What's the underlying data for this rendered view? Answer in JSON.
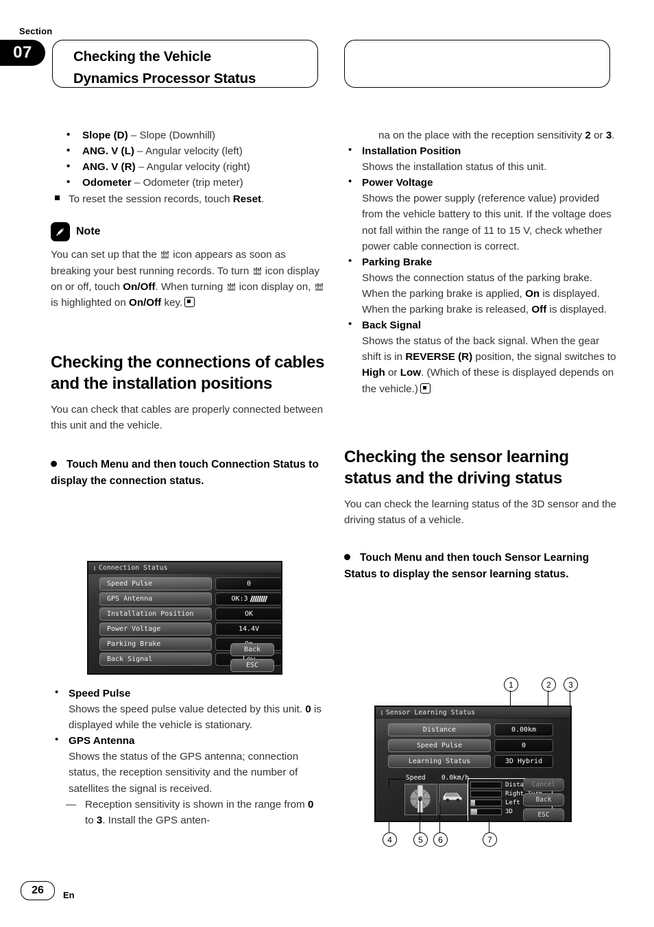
{
  "header": {
    "section_word": "Section",
    "section_number": "07",
    "title_line1": "Checking the Vehicle",
    "title_line2": "Dynamics Processor Status"
  },
  "left_column": {
    "param_list": [
      {
        "term": "Slope (D)",
        "desc": " – Slope (Downhill)"
      },
      {
        "term": "ANG. V (L)",
        "desc": " – Angular velocity (left)"
      },
      {
        "term": "ANG. V (R)",
        "desc": " – Angular velocity (right)"
      },
      {
        "term": "Odometer",
        "desc": " – Odometer (trip meter)"
      }
    ],
    "reset_note_pre": "To reset the session records, touch ",
    "reset_note_bold": "Reset",
    "reset_note_post": ".",
    "note": {
      "icon": "pencil-icon",
      "title": "Note",
      "text_1": "You can set up that the ",
      "text_2": " icon appears as soon as breaking your best running records. To turn ",
      "text_3": " icon display on or off, touch ",
      "bold_onoff_1": "On/Off",
      "text_4": ". When turning ",
      "text_5": " icon display on, ",
      "text_6": " is highlighted on ",
      "bold_onoff_2": "On/Off",
      "text_7": " key."
    },
    "heading": "Checking the connections of cables and the installation positions",
    "intro": "You can check that cables are properly connected between this unit and the vehicle.",
    "procedure": "Touch Menu and then touch Connection Status to display the connection status.",
    "device_screen": {
      "title": "Connection Status",
      "rows": [
        {
          "label": "Speed Pulse",
          "value": "0",
          "has_bars": false
        },
        {
          "label": "GPS Antenna",
          "value": "OK:3",
          "has_bars": true
        },
        {
          "label": "Installation Position",
          "value": "OK",
          "has_bars": false
        },
        {
          "label": "Power Voltage",
          "value": "14.4V",
          "has_bars": false
        },
        {
          "label": "Parking Brake",
          "value": "On",
          "has_bars": false
        },
        {
          "label": "Back Signal",
          "value": "Low",
          "has_bars": false
        }
      ],
      "buttons": [
        "Back",
        "ESC"
      ]
    },
    "items": [
      {
        "term": "Speed Pulse",
        "desc_1": "Shows the speed pulse value detected by this unit. ",
        "bold_1": "0",
        "desc_2": " is displayed while the vehicle is stationary."
      },
      {
        "term": "GPS Antenna",
        "desc_1": "Shows the status of the GPS antenna; connection status, the reception sensitivity and the number of satellites the signal is received.",
        "sub_1": "Reception sensitivity is shown in the range from ",
        "sub_bold_a": "0",
        "sub_2": " to ",
        "sub_bold_b": "3",
        "sub_3": ". Install the GPS anten-"
      }
    ]
  },
  "right_column": {
    "continued_1": "na on the place with the reception sensitivity ",
    "continued_bold_a": "2",
    "continued_2": " or ",
    "continued_bold_b": "3",
    "continued_3": ".",
    "items": [
      {
        "term": "Installation Position",
        "desc": "Shows the installation status of this unit."
      },
      {
        "term": "Power Voltage",
        "desc": "Shows the power supply (reference value) provided from the vehicle battery to this unit. If the voltage does not fall within the range of 11 to 15 V, check whether power cable connection is correct."
      },
      {
        "term": "Parking Brake",
        "desc_1": "Shows the connection status of the parking brake. When the parking brake is applied, ",
        "bold_1": "On",
        "desc_2": " is displayed. When the parking brake is released, ",
        "bold_2": "Off",
        "desc_3": " is displayed."
      },
      {
        "term": "Back Signal",
        "desc_1": "Shows the status of the back signal. When the gear shift is in ",
        "bold_1": "REVERSE (R)",
        "desc_2": " position, the signal switches to ",
        "bold_2": "High",
        "desc_3": " or ",
        "bold_3": "Low",
        "desc_4": ". (Which of these is displayed depends on the vehicle.)"
      }
    ],
    "heading": "Checking the sensor learning status and the driving status",
    "intro": "You can check the learning status of the 3D sensor and the driving status of a vehicle.",
    "procedure": "Touch Menu and then touch Sensor Learning Status to display the sensor learning status.",
    "device_screen": {
      "title": "Sensor Learning Status",
      "rows": [
        {
          "label": "Distance",
          "value": "0.00km"
        },
        {
          "label": "Speed Pulse",
          "value": "0"
        },
        {
          "label": "Learning Status",
          "value": "3D Hybrid"
        }
      ],
      "speed_label": "Speed",
      "speed_value": "0.0km/h",
      "progress": [
        {
          "label": "Distance",
          "percent": 0
        },
        {
          "label": "Right Turn",
          "percent": 0
        },
        {
          "label": "Left Turn",
          "percent": 14
        },
        {
          "label": "3D",
          "percent": 20
        }
      ],
      "buttons": [
        "Cancel",
        "Back",
        "ESC"
      ]
    },
    "callouts": [
      "1",
      "2",
      "3",
      "4",
      "5",
      "6",
      "7"
    ]
  },
  "footer": {
    "page_number": "26",
    "language": "En"
  }
}
